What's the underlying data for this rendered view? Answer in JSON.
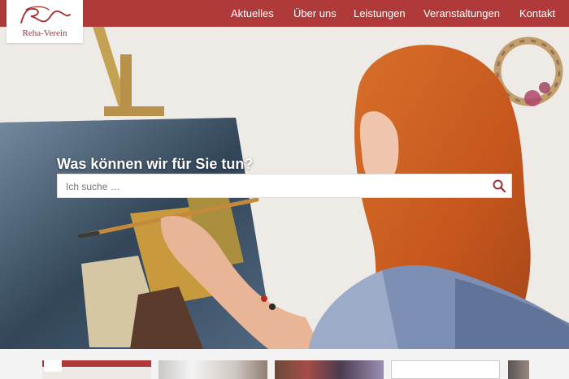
{
  "brand": {
    "color": "#b03a3a",
    "logo_text": "Reha-Verein"
  },
  "nav": {
    "items": [
      {
        "label": "Aktuelles"
      },
      {
        "label": "Über uns"
      },
      {
        "label": "Leistungen"
      },
      {
        "label": "Veranstaltungen"
      },
      {
        "label": "Kontakt"
      }
    ]
  },
  "hero": {
    "title": "Was können wir für Sie tun?",
    "search": {
      "placeholder": "Ich suche …",
      "value": ""
    }
  },
  "icons": {
    "search": "search-icon"
  }
}
